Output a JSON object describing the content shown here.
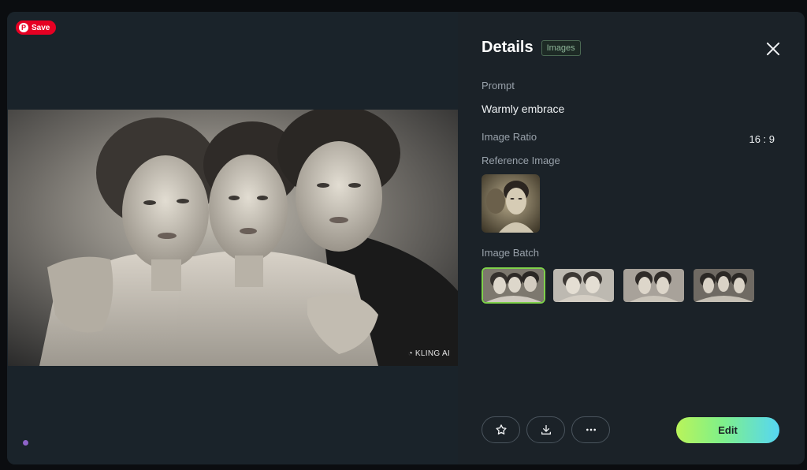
{
  "viewer": {
    "save_label": "Save",
    "watermark": "KLING AI"
  },
  "details": {
    "title": "Details",
    "tag": "Images",
    "prompt_label": "Prompt",
    "prompt_value": "Warmly embrace",
    "ratio_label": "Image Ratio",
    "ratio_value": "16 : 9",
    "reference_label": "Reference Image",
    "batch_label": "Image Batch",
    "batch_count": 4,
    "selected_batch_index": 0
  },
  "actions": {
    "favorite_icon": "star-icon",
    "download_icon": "download-icon",
    "more_icon": "more-icon",
    "edit_label": "Edit"
  },
  "colors": {
    "accent_green": "#7fd14b",
    "edit_gradient_start": "#b9f45a",
    "edit_gradient_end": "#56d6f3",
    "pinterest_red": "#e60023"
  }
}
